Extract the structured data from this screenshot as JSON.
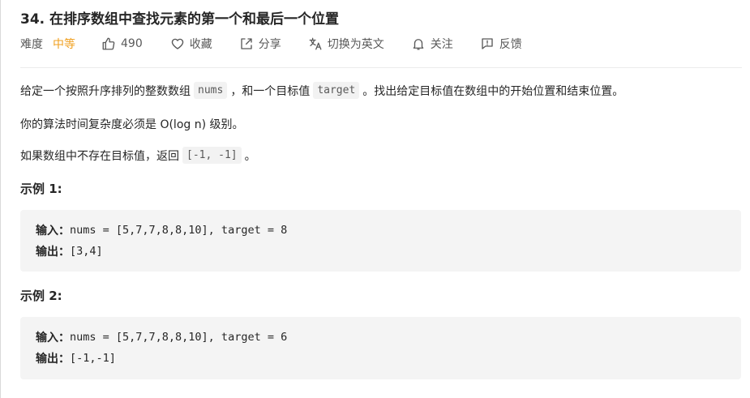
{
  "problem": {
    "title": "34. 在排序数组中查找元素的第一个和最后一个位置",
    "difficulty_label": "难度",
    "difficulty_value": "中等",
    "likes": "490",
    "favorite_label": "收藏",
    "share_label": "分享",
    "translate_label": "切换为英文",
    "follow_label": "关注",
    "feedback_label": "反馈"
  },
  "description": {
    "p1_before": "给定一个按照升序排列的整数数组",
    "p1_code1": "nums",
    "p1_mid": "，和一个目标值",
    "p1_code2": "target",
    "p1_after": "。找出给定目标值在数组中的开始位置和结束位置。",
    "p2": "你的算法时间复杂度必须是 O(log n) 级别。",
    "p3_before": "如果数组中不存在目标值，返回",
    "p3_code": "[-1, -1]",
    "p3_after": "。"
  },
  "examples": [
    {
      "heading": "示例 1:",
      "input_label": "输入：",
      "input_value": "nums = [5,7,7,8,8,10], target = 8",
      "output_label": "输出：",
      "output_value": "[3,4]"
    },
    {
      "heading": "示例 2:",
      "input_label": "输入：",
      "input_value": "nums = [5,7,7,8,8,10], target = 6",
      "output_label": "输出：",
      "output_value": "[-1,-1]"
    }
  ],
  "icons": {
    "like": "thumbs-up-icon",
    "favorite": "heart-icon",
    "share": "share-icon",
    "translate": "translate-icon",
    "follow": "bell-icon",
    "feedback": "feedback-icon"
  },
  "colors": {
    "difficulty_medium": "#f0a020",
    "code_background": "#f4f4f4"
  }
}
